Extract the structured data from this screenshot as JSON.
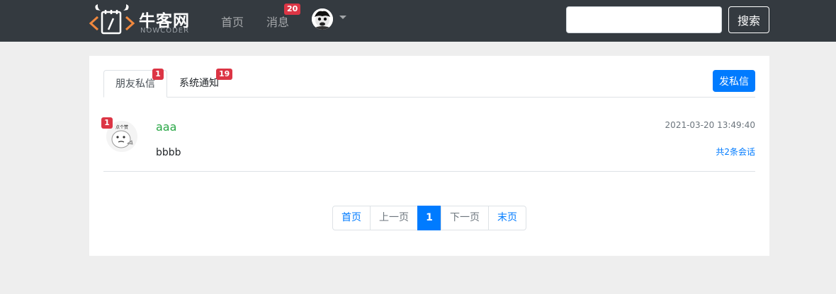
{
  "header": {
    "logo_cn": "牛客网",
    "logo_en": "NOWCODER",
    "nav": {
      "home": "首页",
      "messages": "消息",
      "messages_badge": "20"
    },
    "search": {
      "placeholder": "",
      "value": "",
      "button": "搜索"
    }
  },
  "tabs": {
    "friend_letters": {
      "label": "朋友私信",
      "badge": "1"
    },
    "system_notice": {
      "label": "系统通知",
      "badge": "19"
    },
    "send_button": "发私信"
  },
  "conversations": [
    {
      "unread": "1",
      "username": "aaa",
      "time": "2021-03-20 13:49:40",
      "content": "bbbb",
      "count_text": "共2条会话"
    }
  ],
  "pagination": {
    "first": "首页",
    "prev": "上一页",
    "current": "1",
    "next": "下一页",
    "last": "末页"
  },
  "colors": {
    "navbar": "#343a40",
    "primary": "#007bff",
    "badge": "#dc3545",
    "username": "#28a745"
  }
}
